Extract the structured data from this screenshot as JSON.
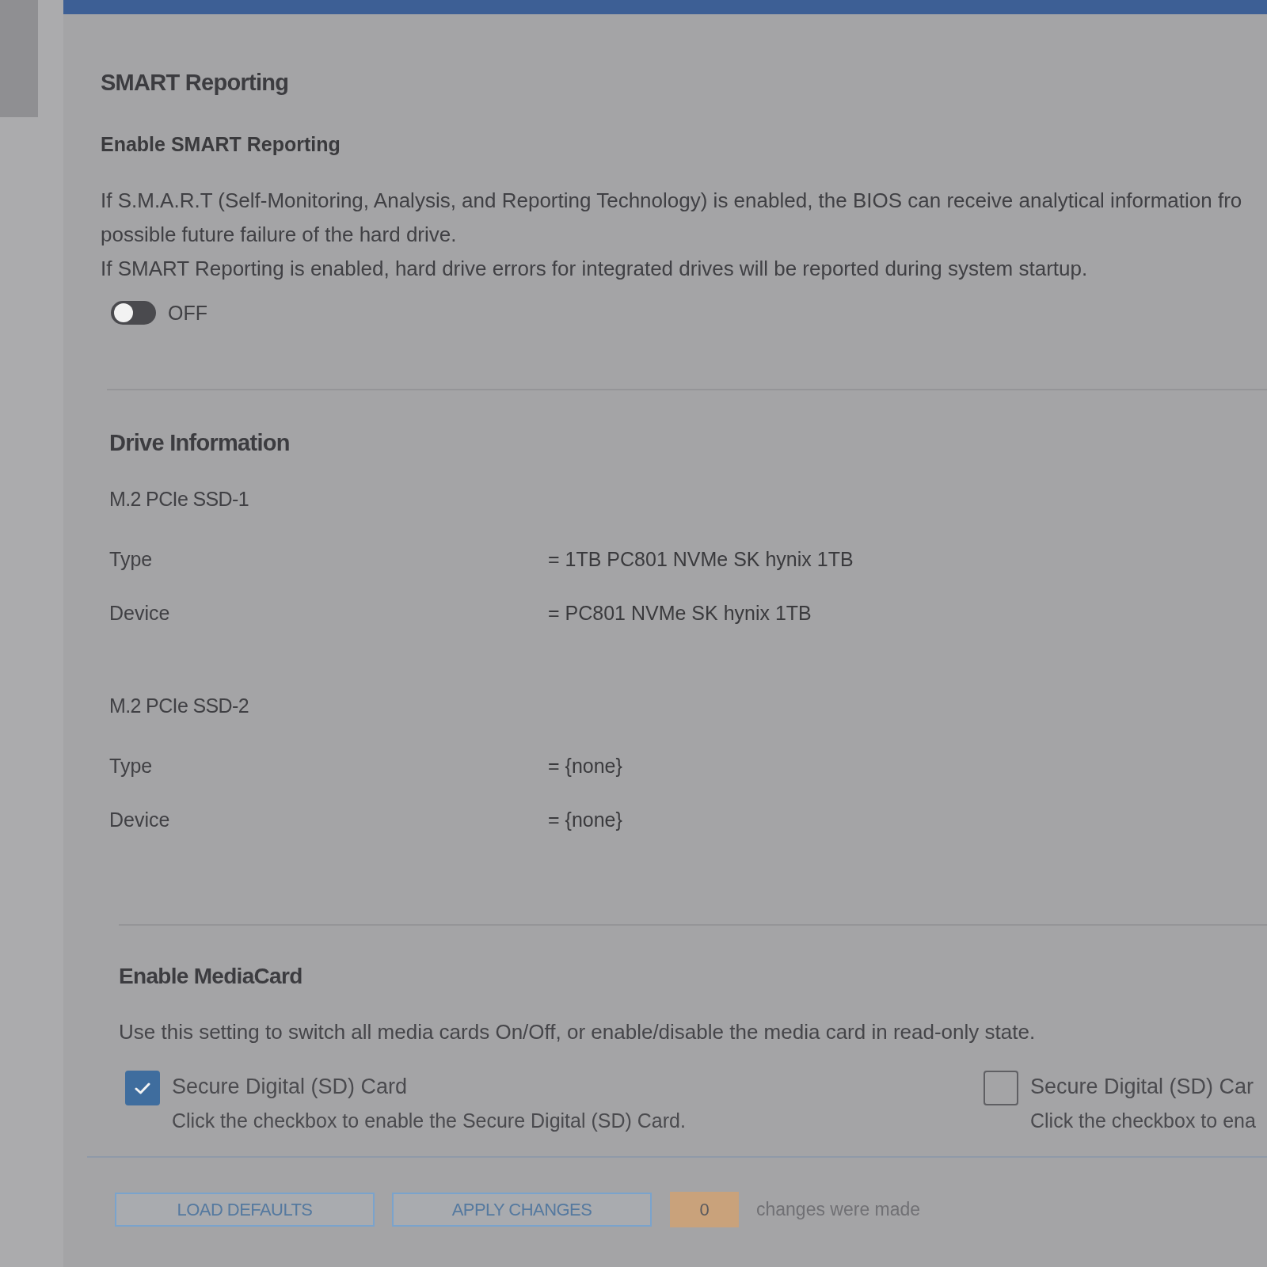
{
  "smart_reporting": {
    "title": "SMART Reporting",
    "setting": {
      "label": "Enable SMART Reporting",
      "description_lines": [
        "If S.M.A.R.T (Self-Monitoring, Analysis, and Reporting Technology) is enabled, the BIOS can receive analytical information fro",
        "possible future failure of the hard drive.",
        "If SMART Reporting is enabled, hard drive errors for integrated drives will be reported during system startup."
      ],
      "toggle": {
        "on": false,
        "label": "OFF"
      }
    }
  },
  "drive_information": {
    "title": "Drive Information",
    "drives": [
      {
        "name": "M.2 PCIe SSD-1",
        "fields": [
          {
            "label": "Type",
            "value": "= 1TB PC801 NVMe SK hynix 1TB"
          },
          {
            "label": "Device",
            "value": "= PC801 NVMe SK hynix 1TB"
          }
        ]
      },
      {
        "name": "M.2 PCIe SSD-2",
        "fields": [
          {
            "label": "Type",
            "value": "= {none}"
          },
          {
            "label": "Device",
            "value": "= {none}"
          }
        ]
      }
    ]
  },
  "media_card": {
    "title": "Enable MediaCard",
    "description": "Use this setting to switch all media cards On/Off, or enable/disable the media card in read-only state.",
    "options": [
      {
        "label": "Secure Digital (SD) Card",
        "hint": "Click the checkbox to enable the Secure Digital (SD) Card.",
        "checked": true
      },
      {
        "label": "Secure Digital (SD) Car",
        "hint": "Click the checkbox to ena",
        "checked": false
      }
    ]
  },
  "footer": {
    "buttons": [
      {
        "label": "LOAD DEFAULTS"
      },
      {
        "label": "APPLY CHANGES"
      }
    ],
    "change_count": "0",
    "change_text": "changes were made"
  }
}
